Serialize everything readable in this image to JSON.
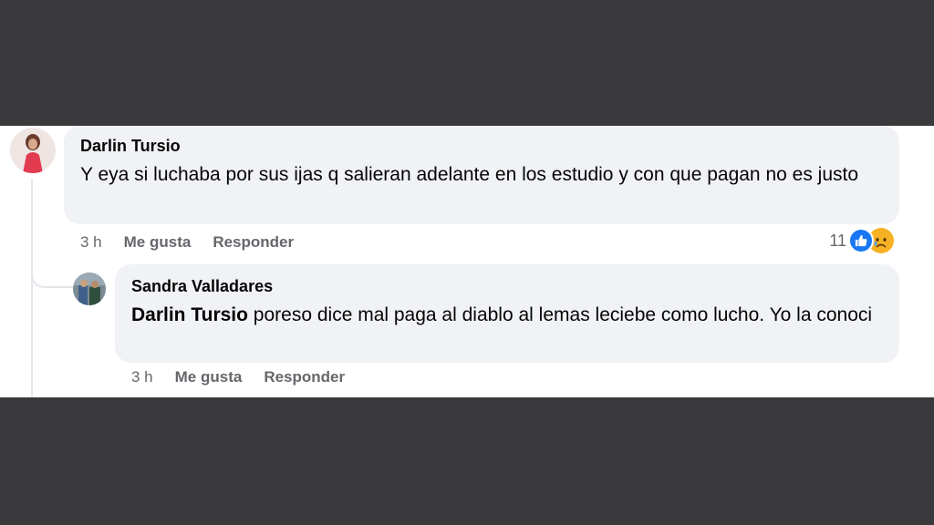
{
  "comments": [
    {
      "author": "Darlin Tursio",
      "text": "Y eya si luchaba por sus ijas q salieran adelante en los estudio y con que pagan no es justo",
      "time": "3 h",
      "like_label": "Me gusta",
      "reply_label": "Responder",
      "reaction_count": "11",
      "reactions": [
        "like-icon",
        "sad-icon"
      ]
    }
  ],
  "replies": [
    {
      "author": "Sandra Valladares",
      "mention": "Darlin Tursio",
      "text": " poreso dice mal paga al diablo al lemas leciebe como lucho. Yo la conoci",
      "time": "3 h",
      "like_label": "Me gusta",
      "reply_label": "Responder"
    }
  ],
  "colors": {
    "bubble": "#f0f2f5",
    "meta_text": "#65676b",
    "like_blue": "#1877f2",
    "sad_yellow": "#f7b125",
    "letterbox": "#3a3a3c"
  }
}
